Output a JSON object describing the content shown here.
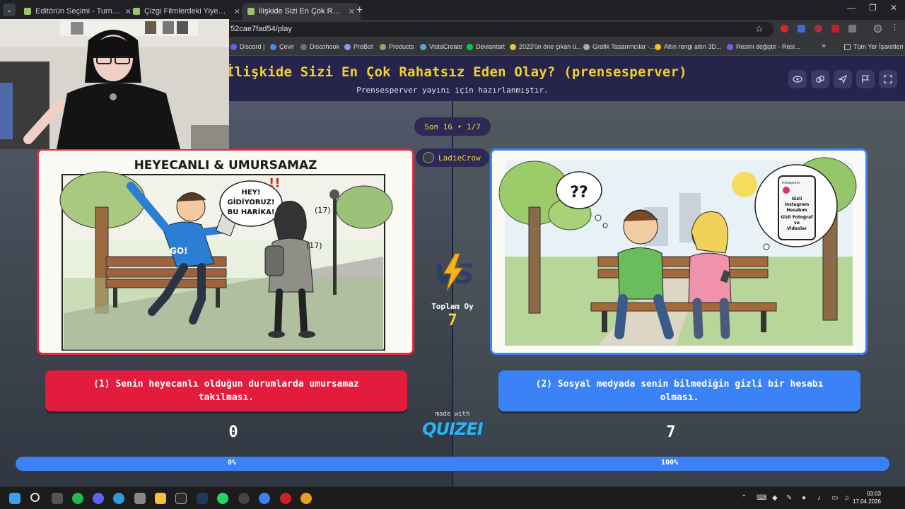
{
  "browser": {
    "tabs": [
      {
        "title": "Editörün Seçimi - Turnuva - Qu",
        "active": false
      },
      {
        "title": "Çizgi Filmlerdeki Yiyecekler - T",
        "active": false
      },
      {
        "title": "İlişkide Sizi En Çok Rahatsız Ed",
        "active": true
      }
    ],
    "url": "52cae7fad54/play",
    "bookmarks": [
      "Discord |",
      "Çevir",
      "Discohook",
      "ProBot",
      "Products",
      "VistaCreate",
      "Deviantart",
      "2023'ün öne çıkan ü...",
      "Grafik Tasarımcılar -...",
      "Altın rengi altın 3D...",
      "Resmi değiştir - Resi...",
      "Tüm Yer İşaretleri"
    ],
    "more": "»"
  },
  "quiz": {
    "title": "İlişkide Sizi En Çok Rahatsız Eden Olay? (prensesperver)",
    "subtitle": "Prensesperver yayını için hazırlanmıştır.",
    "round": "Son 16 • 1/7",
    "user": "LadieCrow",
    "total_label": "Toplam Oy",
    "total_votes": "7",
    "made_with": "made with",
    "brand": "QUIZEI",
    "accent": "#f1d23a"
  },
  "left": {
    "image_heading": "HEYECANLI & UMURSAMAZ",
    "bubble_text": "HEY! GİDİYORUZ! BU HARİKA!",
    "age_a": "(17)",
    "age_b": "(17)",
    "shirt": "GO!",
    "option": "(1) Senin heyecanlı olduğun durumlarda umursamaz takılması.",
    "votes": "0",
    "percent": "0%",
    "fraction": 0,
    "color": "#e31b3c"
  },
  "right": {
    "thought": "??",
    "phone_text": "Gizli Instagram Hesabım Gizli Fotoğraf ve Videolar",
    "phone_header": "Instagram",
    "option": "(2) Sosyal medyada senin bilmediğin gizli bir hesabı olması.",
    "votes": "7",
    "percent": "100%",
    "fraction": 1,
    "color": "#3b82f6"
  },
  "taskbar": {
    "time": "03:03",
    "date": "17.04.2026"
  }
}
